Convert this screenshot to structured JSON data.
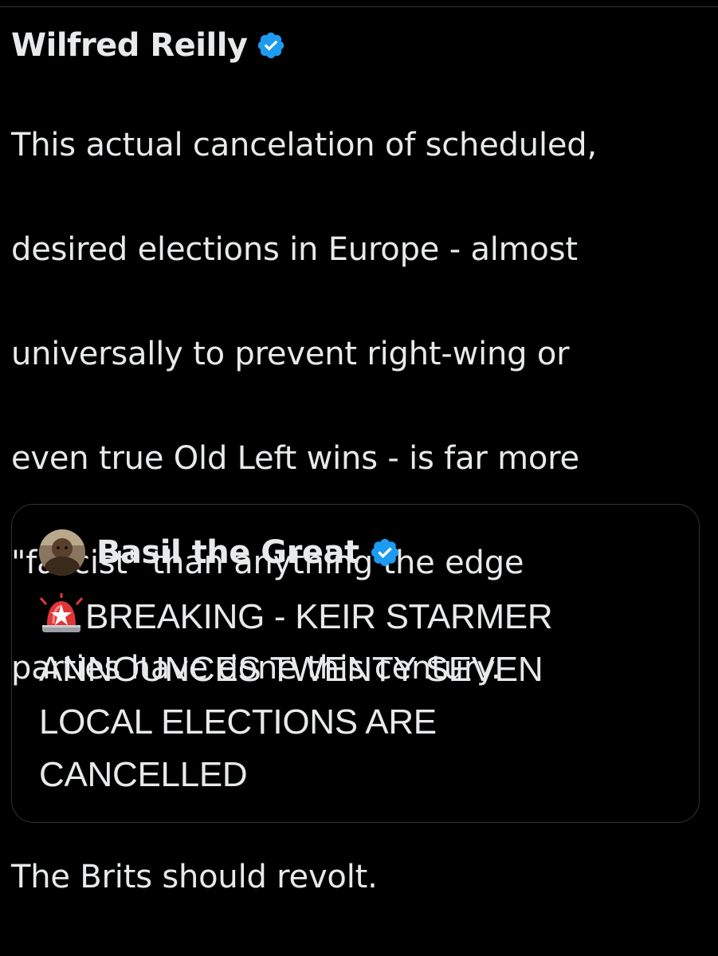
{
  "tweet": {
    "author_name": "Wilfred Reilly",
    "verified_icon": "verified-badge-icon",
    "body_lines": [
      "This actual cancelation of scheduled,",
      "desired elections in Europe - almost",
      "universally to prevent right-wing or",
      "even true Old Left wins - is far more",
      "\"fascist\" than anything the edge",
      "parties have done this century."
    ],
    "closing_line": "The Brits should revolt."
  },
  "quote": {
    "author_name": "Basil the Great",
    "avatar_icon": "avatar",
    "verified_icon": "verified-badge-icon",
    "siren_icon": "police-siren-emoji",
    "lines": [
      "BREAKING - KEIR STARMER",
      "ANNOUNCES TWENTY SEVEN",
      "LOCAL ELECTIONS ARE",
      "CANCELLED"
    ]
  },
  "colors": {
    "background": "#000000",
    "text": "#e7e9ea",
    "verified": "#1d9bf0",
    "border": "#2f3336"
  }
}
